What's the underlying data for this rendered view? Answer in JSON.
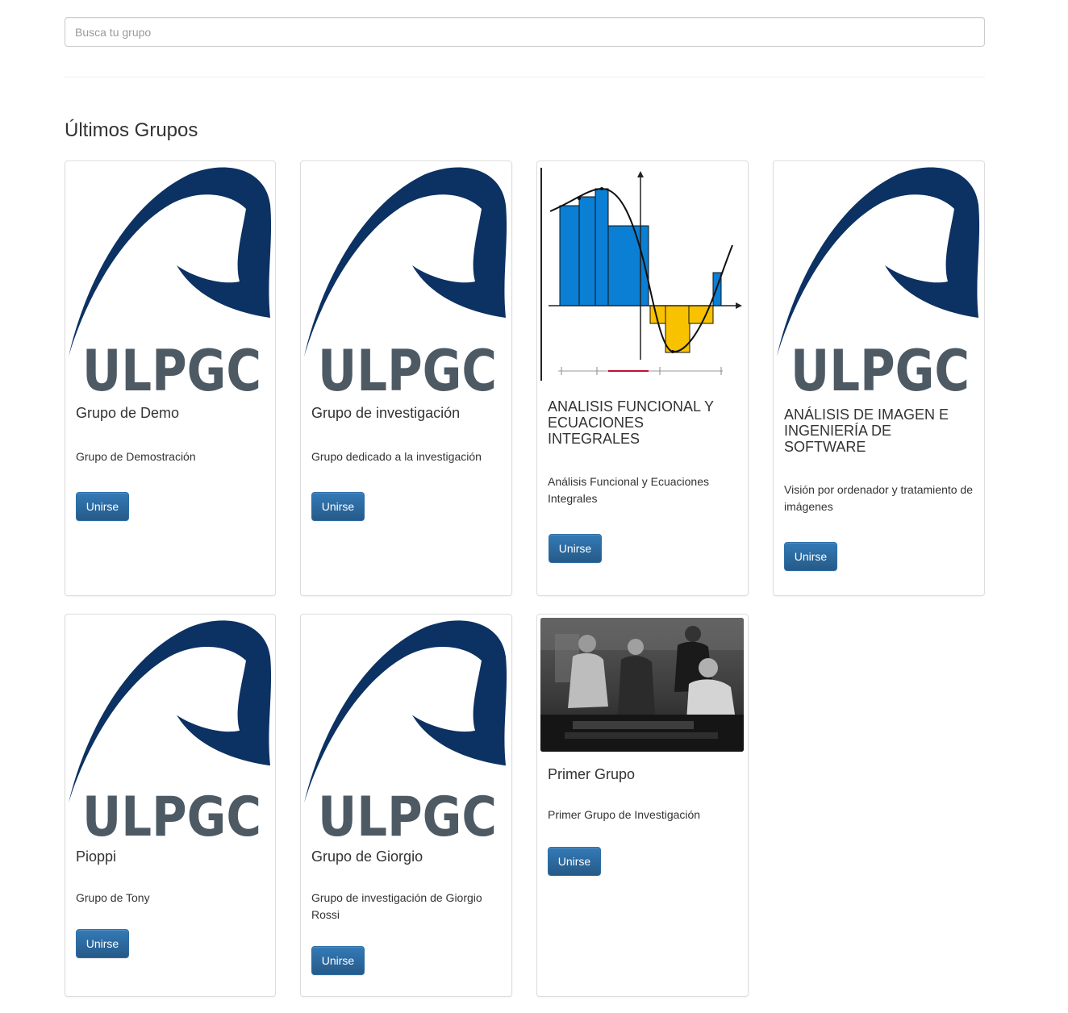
{
  "search": {
    "placeholder": "Busca tu grupo"
  },
  "section": {
    "title": "Últimos Grupos"
  },
  "colors": {
    "logo_blue": "#0c3163",
    "logo_gray": "#4d5a64",
    "button_blue": "#337ab7",
    "chart_blue": "#0a7fd4",
    "chart_yellow": "#f8c200"
  },
  "groups": [
    {
      "image": "ulpgc-logo",
      "logo_text": "ULPGC",
      "title": "Grupo de Demo",
      "description": "Grupo de Demostración",
      "button": "Unirse"
    },
    {
      "image": "ulpgc-logo",
      "logo_text": "ULPGC",
      "title": "Grupo de investigación",
      "description": "Grupo dedicado a la investigación",
      "button": "Unirse"
    },
    {
      "image": "riemann-sum-chart",
      "title": "ANALISIS FUNCIONAL Y ECUACIONES INTEGRALES",
      "description": "Análisis Funcional y Ecuaciones Integrales",
      "button": "Unirse"
    },
    {
      "image": "ulpgc-logo",
      "logo_text": "ULPGC",
      "title": "ANÁLISIS DE IMAGEN E INGENIERÍA DE SOFTWARE",
      "description": "Visión por ordenador y tratamiento de imágenes",
      "button": "Unirse"
    },
    {
      "image": "ulpgc-logo",
      "logo_text": "ULPGC",
      "title": "Pioppi",
      "description": "Grupo de Tony",
      "button": "Unirse"
    },
    {
      "image": "ulpgc-logo",
      "logo_text": "ULPGC",
      "title": "Grupo de Giorgio",
      "description": "Grupo de investigación de Giorgio Rossi",
      "button": "Unirse"
    },
    {
      "image": "band-photo",
      "title": "Primer Grupo",
      "description": "Primer Grupo de Investigación",
      "button": "Unirse"
    }
  ]
}
